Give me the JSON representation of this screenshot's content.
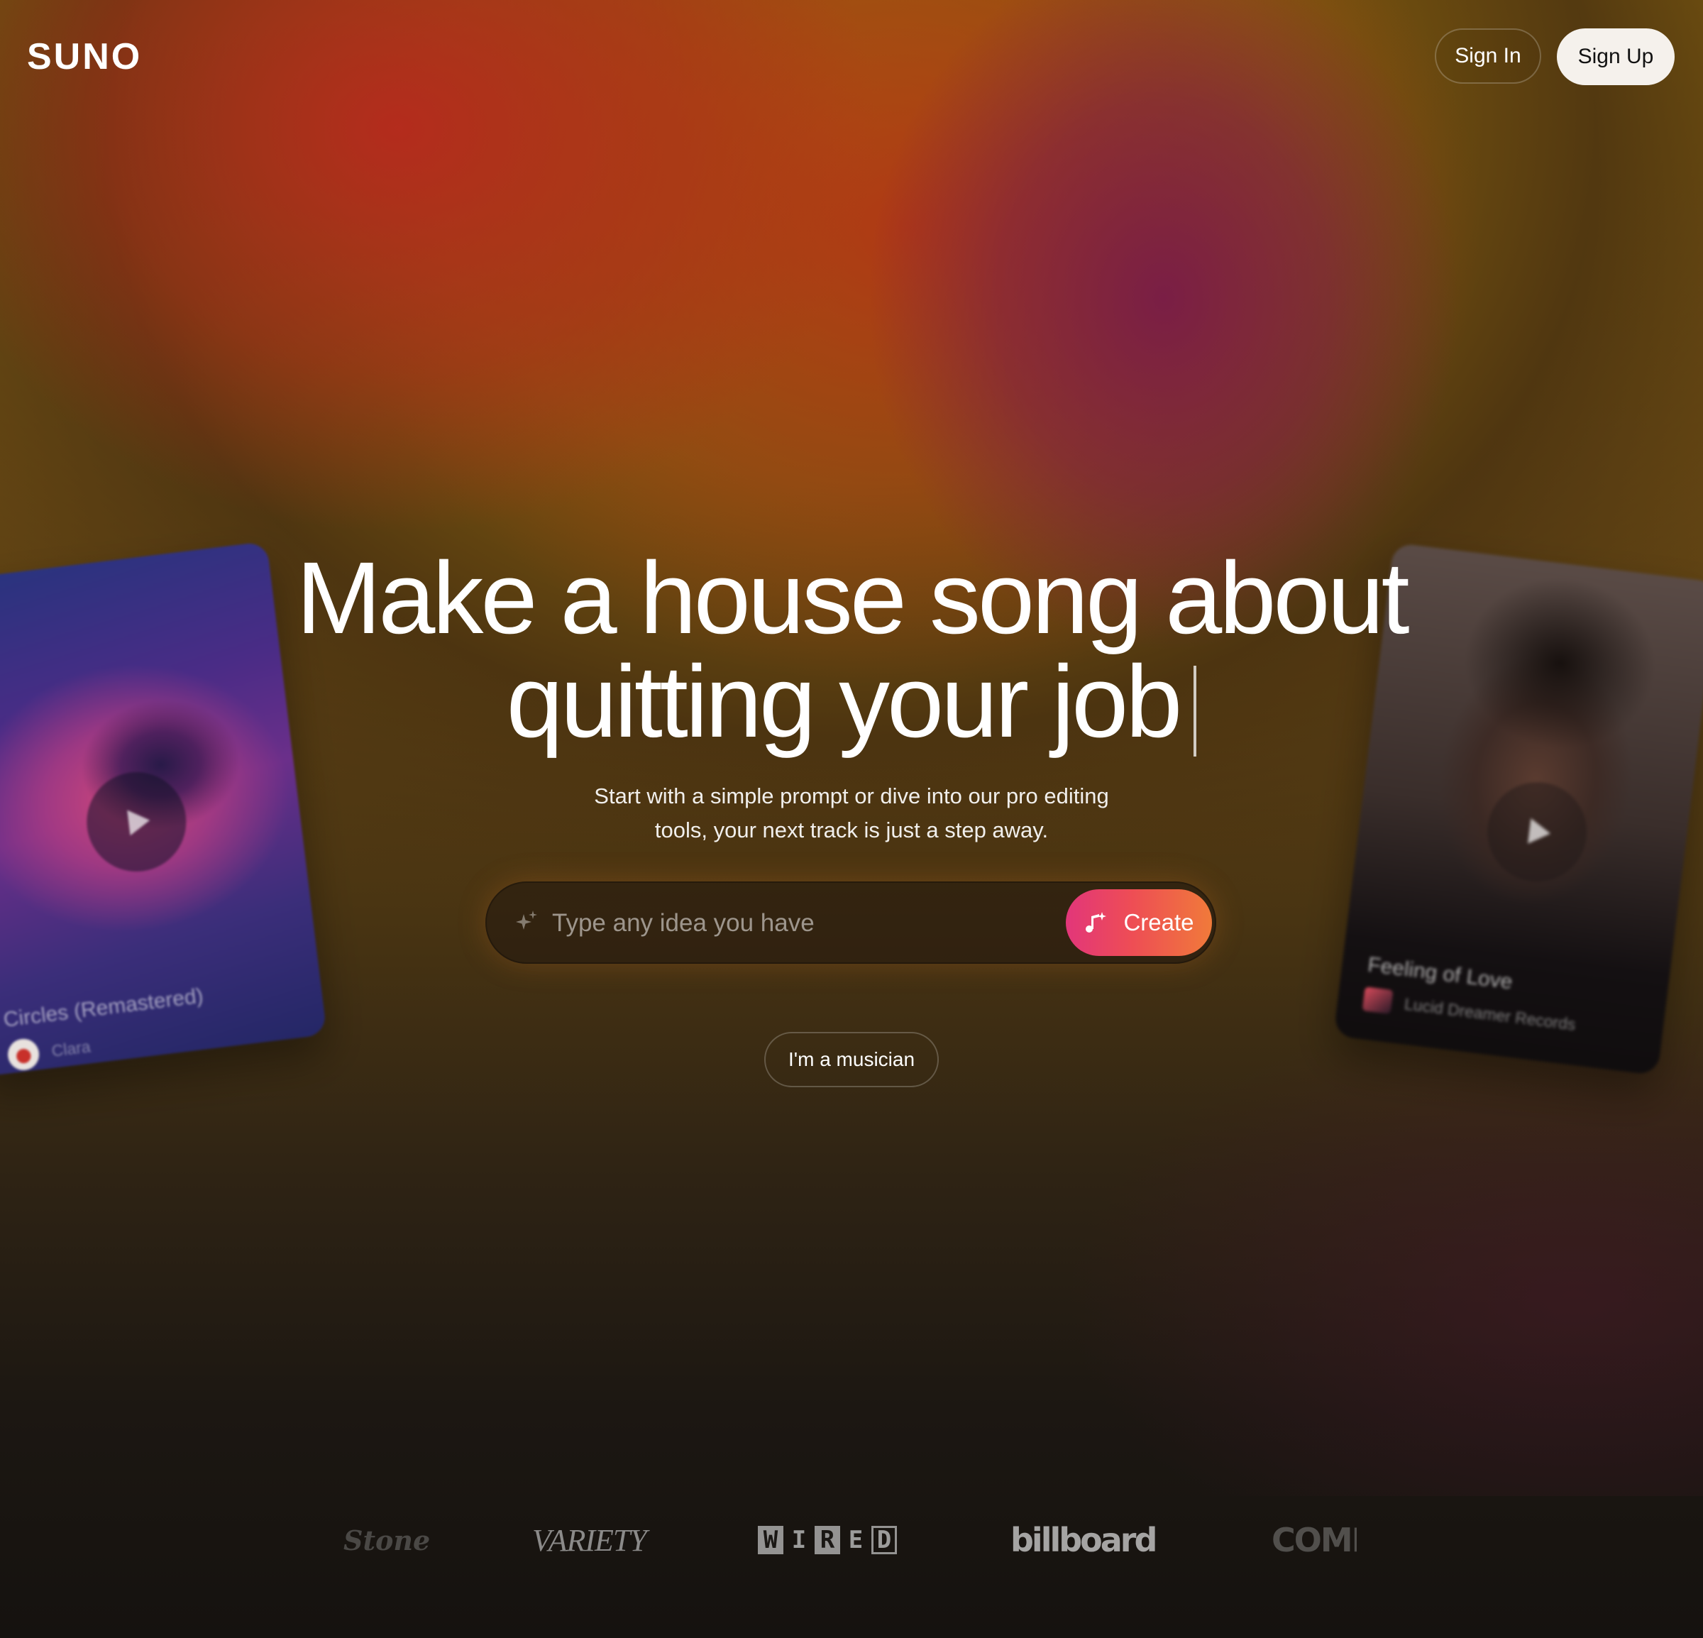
{
  "header": {
    "logo": "SUNO",
    "sign_in": "Sign In",
    "sign_up": "Sign Up"
  },
  "hero": {
    "title_line1": "Make a house song about",
    "title_line2": "quitting your job",
    "subtitle_line1": "Start with a simple prompt or dive into our pro editing",
    "subtitle_line2": "tools, your next track is just a step away.",
    "input_placeholder": "Type any idea you have",
    "create_label": "Create",
    "musician_label": "I'm a musician"
  },
  "cards": [
    {
      "title": "Circles (Remastered)",
      "artist": "Clara"
    },
    {
      "title": "Feeling of Love",
      "artist": "Lucid Dreamer Records"
    }
  ],
  "press": {
    "rolling_stone": "Stone",
    "variety": "VARIETY",
    "wired": [
      "W",
      "I",
      "R",
      "E",
      "D"
    ],
    "billboard": "billboard",
    "complex": "COMPL"
  },
  "icons": {
    "sparkle": "sparkle-icon",
    "create": "music-note-sparkle-icon",
    "play": "play-icon"
  },
  "colors": {
    "signup_bg": "#f5f1ec",
    "create_gradient_start": "#e2367a",
    "create_gradient_end": "#f07a3a"
  }
}
